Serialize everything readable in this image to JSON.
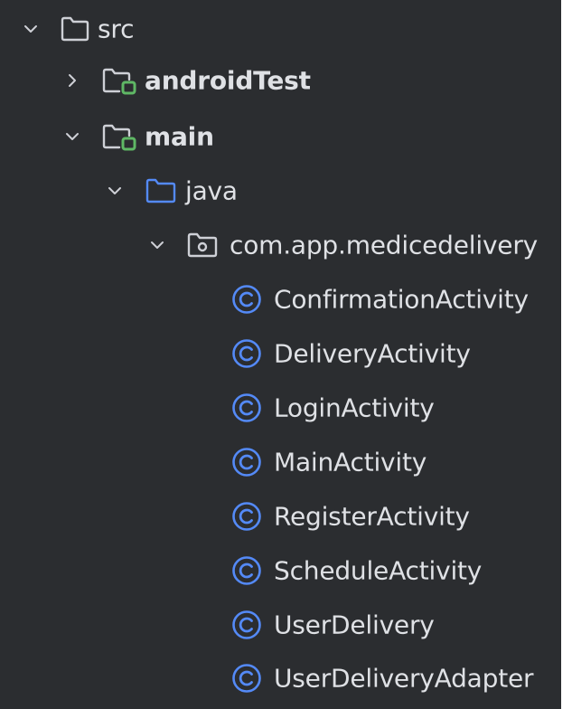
{
  "project_tree": {
    "src": {
      "label": "src",
      "expanded": true,
      "icon": "folder-icon"
    },
    "androidTest": {
      "label": "androidTest",
      "expanded": false,
      "icon": "module-folder-icon"
    },
    "main": {
      "label": "main",
      "expanded": true,
      "icon": "module-folder-icon"
    },
    "java": {
      "label": "java",
      "expanded": true,
      "icon": "source-folder-icon"
    },
    "package": {
      "label": "com.app.medicedelivery",
      "expanded": true,
      "icon": "package-icon"
    },
    "classes": [
      {
        "label": "ConfirmationActivity",
        "icon": "class-icon"
      },
      {
        "label": "DeliveryActivity",
        "icon": "class-icon"
      },
      {
        "label": "LoginActivity",
        "icon": "class-icon"
      },
      {
        "label": "MainActivity",
        "icon": "class-icon"
      },
      {
        "label": "RegisterActivity",
        "icon": "class-icon"
      },
      {
        "label": "ScheduleActivity",
        "icon": "class-icon"
      },
      {
        "label": "UserDelivery",
        "icon": "class-icon"
      },
      {
        "label": "UserDeliveryAdapter",
        "icon": "class-icon"
      }
    ]
  },
  "colors": {
    "background": "#2b2d30",
    "text": "#dfe1e5",
    "folder_outline": "#ced0d6",
    "module_badge": "#5fb865",
    "source_folder": "#548af7",
    "class_icon": "#548af7"
  }
}
